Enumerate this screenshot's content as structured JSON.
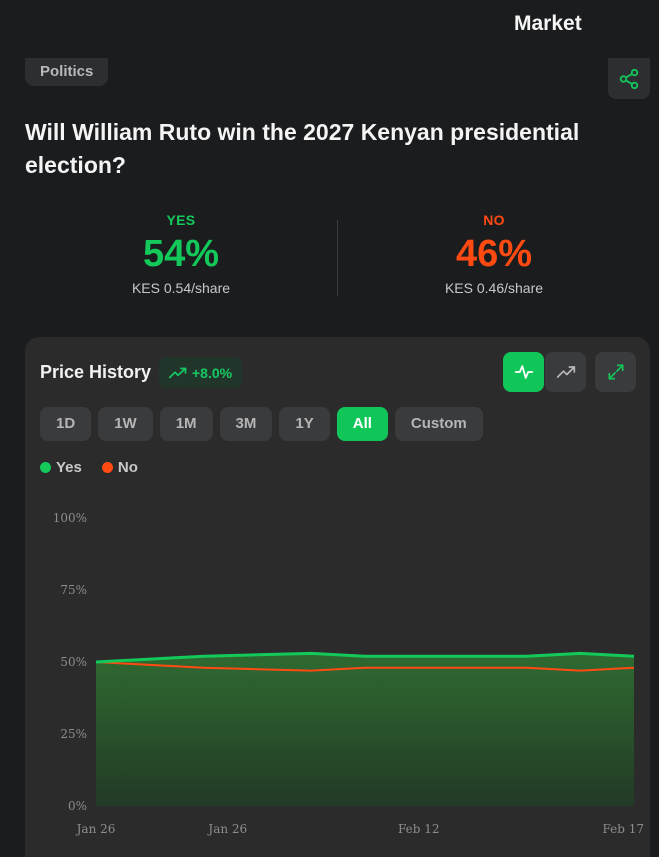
{
  "header": {
    "title": "Market"
  },
  "market": {
    "category": "Politics",
    "question": "Will William Ruto win the 2027 Kenyan presidential election?",
    "yes": {
      "label": "YES",
      "percent": "54%",
      "price": "KES 0.54/share"
    },
    "no": {
      "label": "NO",
      "percent": "46%",
      "price": "KES 0.46/share"
    }
  },
  "price_history": {
    "title": "Price History",
    "change": "+8.0%",
    "ranges": [
      "1D",
      "1W",
      "1M",
      "3M",
      "1Y",
      "All",
      "Custom"
    ],
    "selected_range": "All"
  },
  "colors": {
    "yes": "#12c95a",
    "no": "#ff4a12",
    "accent": "#11c659"
  },
  "icons": [
    "share-icon",
    "trend-up-icon",
    "activity-icon",
    "line-chart-icon",
    "expand-icon"
  ],
  "chart_data": {
    "type": "area",
    "x": [
      "Jan 26",
      "",
      "Jan 26",
      "",
      "",
      "",
      "",
      "Feb 12",
      "",
      "",
      "Feb 17"
    ],
    "xticks": [
      "Jan 26",
      "Jan 26",
      "Feb 12",
      "Feb 17"
    ],
    "yticks": [
      "100%",
      "75%",
      "50%",
      "25%",
      "0%"
    ],
    "ylim": [
      0,
      100
    ],
    "legend_position": "top-left",
    "series": [
      {
        "name": "Yes",
        "values": [
          50,
          51,
          52,
          52.5,
          53,
          52,
          52,
          52,
          52,
          53,
          52
        ]
      },
      {
        "name": "No",
        "values": [
          50,
          49,
          48,
          47.5,
          47,
          48,
          48,
          48,
          48,
          47,
          48
        ]
      }
    ]
  }
}
